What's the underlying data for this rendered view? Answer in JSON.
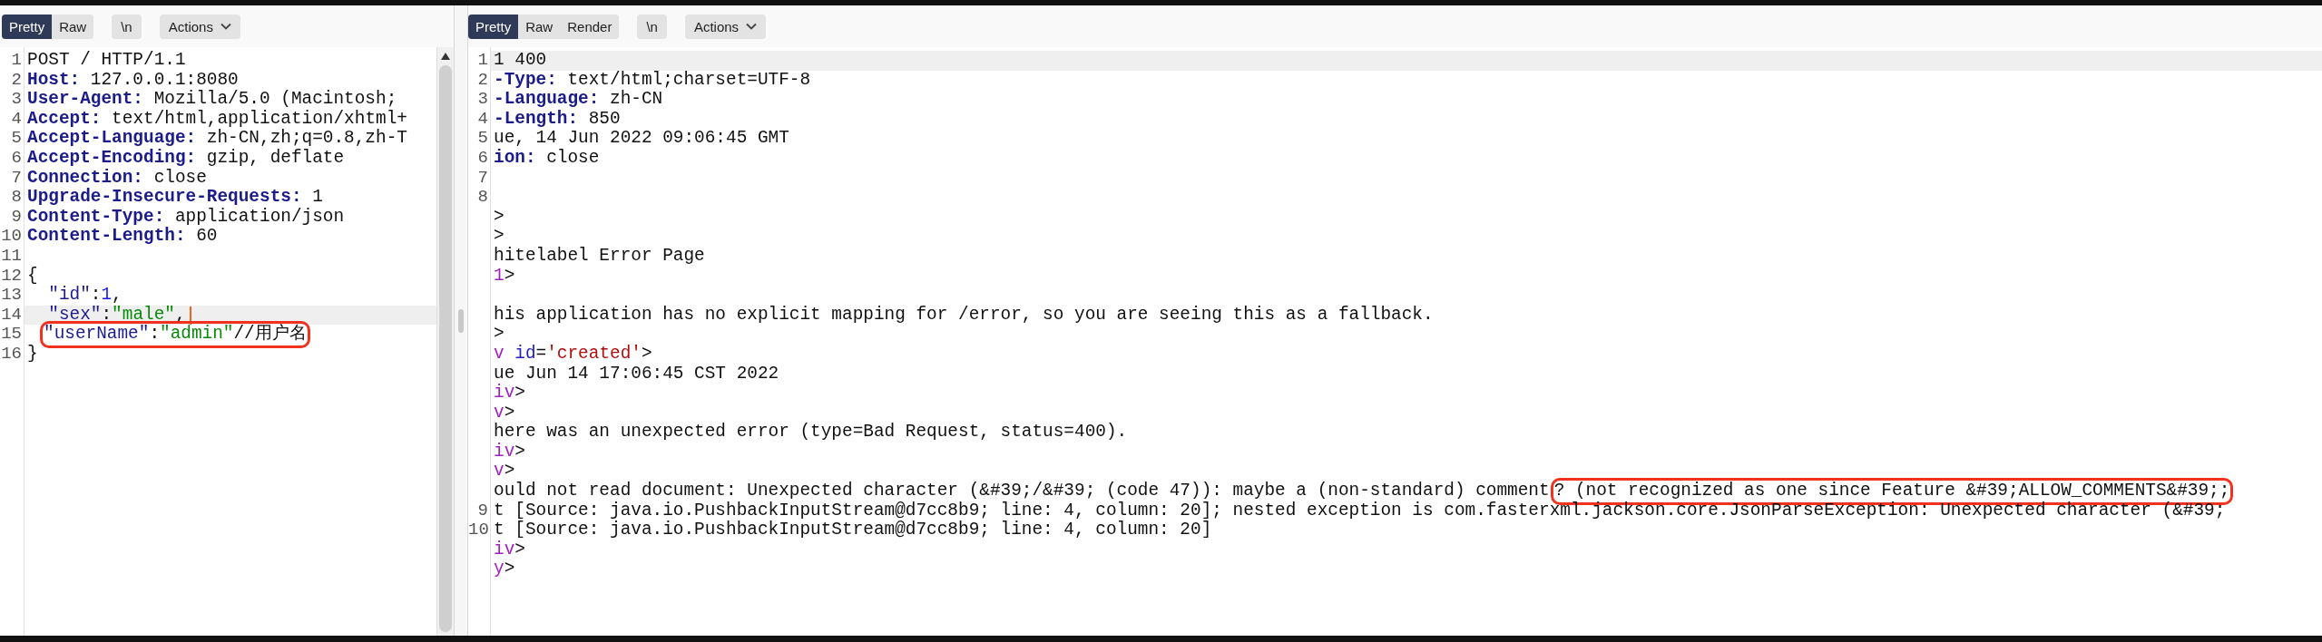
{
  "request": {
    "tabs": [
      {
        "label": "Pretty",
        "selected": true
      },
      {
        "label": "Raw",
        "selected": false
      }
    ],
    "wrap_button": "\\n",
    "actions_button": "Actions",
    "lines": [
      {
        "number": "1",
        "current": false,
        "tokens": [
          {
            "kind": "plain",
            "text": "POST / HTTP/1.1"
          }
        ]
      },
      {
        "number": "2",
        "current": false,
        "tokens": [
          {
            "kind": "header",
            "text": "Host:"
          },
          {
            "kind": "plain",
            "text": " 127.0.0.1:8080"
          }
        ]
      },
      {
        "number": "3",
        "current": false,
        "tokens": [
          {
            "kind": "header",
            "text": "User-Agent:"
          },
          {
            "kind": "plain",
            "text": " Mozilla/5.0 (Macintosh;"
          }
        ]
      },
      {
        "number": "4",
        "current": false,
        "tokens": [
          {
            "kind": "header",
            "text": "Accept:"
          },
          {
            "kind": "plain",
            "text": " text/html,application/xhtml+"
          }
        ]
      },
      {
        "number": "5",
        "current": false,
        "tokens": [
          {
            "kind": "header",
            "text": "Accept-Language:"
          },
          {
            "kind": "plain",
            "text": " zh-CN,zh;q=0.8,zh-T"
          }
        ]
      },
      {
        "number": "6",
        "current": false,
        "tokens": [
          {
            "kind": "header",
            "text": "Accept-Encoding:"
          },
          {
            "kind": "plain",
            "text": " gzip, deflate"
          }
        ]
      },
      {
        "number": "7",
        "current": false,
        "tokens": [
          {
            "kind": "header",
            "text": "Connection:"
          },
          {
            "kind": "plain",
            "text": " close"
          }
        ]
      },
      {
        "number": "8",
        "current": false,
        "tokens": [
          {
            "kind": "header",
            "text": "Upgrade-Insecure-Requests:"
          },
          {
            "kind": "plain",
            "text": " 1"
          }
        ]
      },
      {
        "number": "9",
        "current": false,
        "tokens": [
          {
            "kind": "header",
            "text": "Content-Type:"
          },
          {
            "kind": "plain",
            "text": " application/json"
          }
        ]
      },
      {
        "number": "10",
        "current": false,
        "tokens": [
          {
            "kind": "header",
            "text": "Content-Length:"
          },
          {
            "kind": "plain",
            "text": " 60"
          }
        ]
      },
      {
        "number": "11",
        "current": false
      },
      {
        "number": "12",
        "current": false,
        "tokens": [
          {
            "kind": "plain",
            "text": "{"
          }
        ]
      },
      {
        "number": "13",
        "current": false,
        "tokens": [
          {
            "kind": "key",
            "text": "  \"id\""
          },
          {
            "kind": "plain",
            "text": ":"
          },
          {
            "kind": "number",
            "text": "1"
          },
          {
            "kind": "plain",
            "text": ","
          }
        ]
      },
      {
        "number": "14",
        "current": true,
        "caret": true,
        "tokens": [
          {
            "kind": "key",
            "text": "  \"sex\""
          },
          {
            "kind": "plain",
            "text": ":"
          },
          {
            "kind": "string",
            "text": "\"male\""
          },
          {
            "kind": "plain",
            "text": ","
          }
        ]
      },
      {
        "number": "15",
        "current": false,
        "boxed_tokens": [
          {
            "kind": "key",
            "text": "\"userName\""
          },
          {
            "kind": "plain",
            "text": ":"
          },
          {
            "kind": "string",
            "text": "\"admin\""
          },
          {
            "kind": "plain",
            "text": "//用户名"
          }
        ]
      },
      {
        "number": "16",
        "current": false,
        "tokens": [
          {
            "kind": "plain",
            "text": "}"
          }
        ]
      }
    ]
  },
  "response": {
    "tabs": [
      {
        "label": "Pretty",
        "selected": true
      },
      {
        "label": "Raw",
        "selected": false
      },
      {
        "label": "Render",
        "selected": false
      }
    ],
    "wrap_button": "\\n",
    "actions_button": "Actions",
    "lines": [
      {
        "number": "1",
        "current": true,
        "tokens": [
          {
            "kind": "plain",
            "text": "1 400"
          }
        ]
      },
      {
        "number": "2",
        "current": false,
        "tokens": [
          {
            "kind": "header",
            "text": "-Type:"
          },
          {
            "kind": "plain",
            "text": " text/html;charset=UTF-8"
          }
        ]
      },
      {
        "number": "3",
        "current": false,
        "tokens": [
          {
            "kind": "header",
            "text": "-Language:"
          },
          {
            "kind": "plain",
            "text": " zh-CN"
          }
        ]
      },
      {
        "number": "4",
        "current": false,
        "tokens": [
          {
            "kind": "header",
            "text": "-Length:"
          },
          {
            "kind": "plain",
            "text": " 850"
          }
        ]
      },
      {
        "number": "5",
        "current": false,
        "tokens": [
          {
            "kind": "plain",
            "text": "ue, 14 Jun 2022 09:06:45 GMT"
          }
        ]
      },
      {
        "number": "6",
        "current": false,
        "tokens": [
          {
            "kind": "header",
            "text": "ion:"
          },
          {
            "kind": "plain",
            "text": " close"
          }
        ]
      },
      {
        "number": "7",
        "current": false
      },
      {
        "number": "8",
        "current": false
      },
      {
        "current": false,
        "tokens": [
          {
            "kind": "plain",
            "text": ">"
          }
        ]
      },
      {
        "current": false,
        "tokens": [
          {
            "kind": "plain",
            "text": ">"
          }
        ]
      },
      {
        "current": false,
        "tokens": [
          {
            "kind": "plain",
            "text": "hitelabel Error Page"
          }
        ]
      },
      {
        "current": false,
        "tokens": [
          {
            "kind": "tag",
            "text": "1"
          },
          {
            "kind": "plain",
            "text": ">"
          }
        ]
      },
      {
        "current": false
      },
      {
        "current": false,
        "tokens": [
          {
            "kind": "plain",
            "text": "his application has no explicit mapping for /error, so you are seeing this as a fallback."
          }
        ]
      },
      {
        "current": false,
        "tokens": [
          {
            "kind": "plain",
            "text": ">"
          }
        ]
      },
      {
        "current": false,
        "tokens": [
          {
            "kind": "tag",
            "text": "v"
          },
          {
            "kind": "attr",
            "text": " id"
          },
          {
            "kind": "plain",
            "text": "="
          },
          {
            "kind": "value",
            "text": "'created'"
          },
          {
            "kind": "plain",
            "text": ">"
          }
        ]
      },
      {
        "current": false,
        "tokens": [
          {
            "kind": "plain",
            "text": "ue Jun 14 17:06:45 CST 2022"
          }
        ]
      },
      {
        "current": false,
        "tokens": [
          {
            "kind": "tag",
            "text": "iv"
          },
          {
            "kind": "plain",
            "text": ">"
          }
        ]
      },
      {
        "current": false,
        "tokens": [
          {
            "kind": "tag",
            "text": "v"
          },
          {
            "kind": "plain",
            "text": ">"
          }
        ]
      },
      {
        "current": false,
        "tokens": [
          {
            "kind": "plain",
            "text": "here was an unexpected error (type=Bad Request, status=400)."
          }
        ]
      },
      {
        "current": false,
        "tokens": [
          {
            "kind": "tag",
            "text": "iv"
          },
          {
            "kind": "plain",
            "text": ">"
          }
        ]
      },
      {
        "current": false,
        "tokens": [
          {
            "kind": "tag",
            "text": "v"
          },
          {
            "kind": "plain",
            "text": ">"
          }
        ]
      },
      {
        "current": false,
        "tokens": [
          {
            "kind": "plain",
            "text": "ould not read document: Unexpected character (&#39;/&#39; (code 47)): maybe a (non-standard) comment"
          }
        ],
        "boxed_tokens": [
          {
            "kind": "plain",
            "text": "? (not recognized as one since Feature &#39;ALLOW_COMMENTS&#39;;"
          }
        ]
      },
      {
        "number": "9",
        "current": false,
        "tokens": [
          {
            "kind": "plain",
            "text": "t [Source: java.io.PushbackInputStream@d7cc8b9; line: 4, column: 20]; nested exception is com.fasterxml.jackson.core.JsonParseException: Unexpected character (&#39;"
          }
        ]
      },
      {
        "number": "10",
        "current": false,
        "tokens": [
          {
            "kind": "plain",
            "text": "t [Source: java.io.PushbackInputStream@d7cc8b9; line: 4, column: 20]"
          }
        ]
      },
      {
        "current": false,
        "tokens": [
          {
            "kind": "tag",
            "text": "iv"
          },
          {
            "kind": "plain",
            "text": ">"
          }
        ]
      },
      {
        "current": false,
        "tokens": [
          {
            "kind": "tag",
            "text": "y"
          },
          {
            "kind": "plain",
            "text": ">"
          }
        ]
      }
    ]
  }
}
